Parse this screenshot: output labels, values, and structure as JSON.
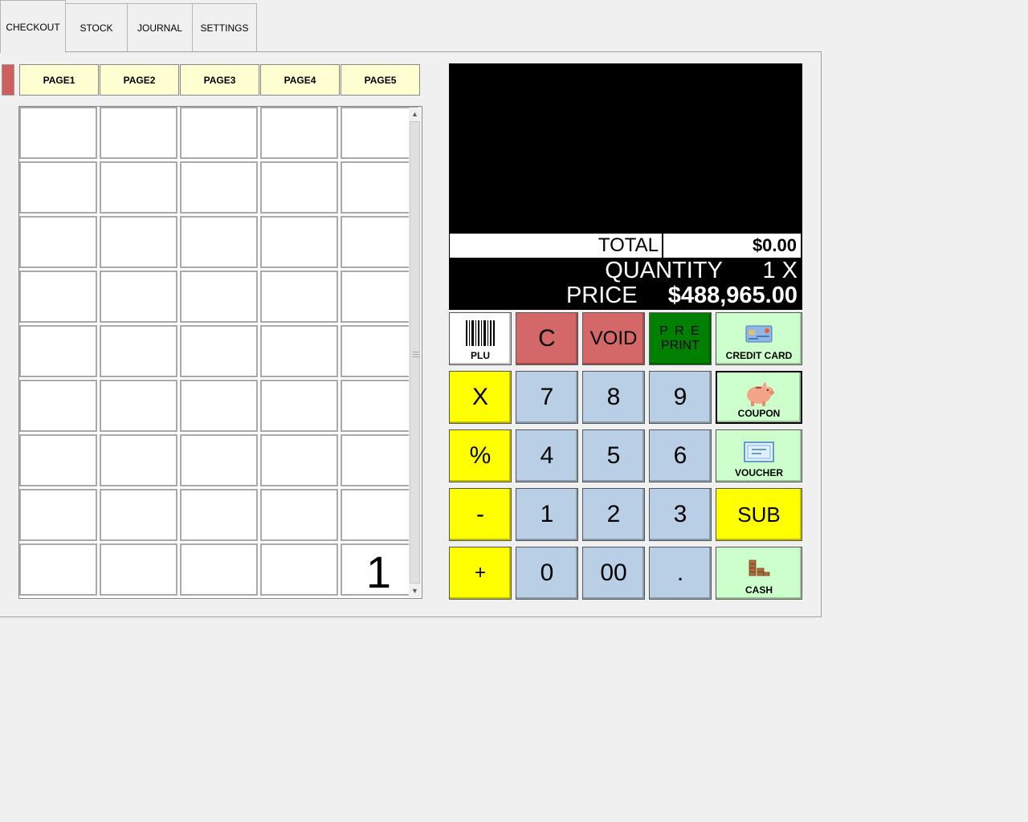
{
  "tabs": [
    {
      "label": "CHECKOUT",
      "active": true
    },
    {
      "label": "STOCK"
    },
    {
      "label": "JOURNAL"
    },
    {
      "label": "SETTINGS"
    }
  ],
  "pages": [
    "PAGE1",
    "PAGE2",
    "PAGE3",
    "PAGE4",
    "PAGE5"
  ],
  "grid": {
    "rows": 9,
    "cols": 5,
    "page_number": "1"
  },
  "display": {
    "total_label": "TOTAL",
    "total_value": "$0.00",
    "quantity_label": "QUANTITY",
    "quantity_value": "1 X",
    "price_label": "PRICE",
    "price_value": "$488,965.00"
  },
  "keys": {
    "plu": "PLU",
    "clear": "C",
    "void": "VOID",
    "preprint_line1": "P R E",
    "preprint_line2": "PRINT",
    "credit_card": "CREDIT CARD",
    "multiply": "X",
    "k7": "7",
    "k8": "8",
    "k9": "9",
    "coupon": "COUPON",
    "percent": "%",
    "k4": "4",
    "k5": "5",
    "k6": "6",
    "voucher": "VOUCHER",
    "minus": "-",
    "k1": "1",
    "k2": "2",
    "k3": "3",
    "sub": "SUB",
    "plus": "+",
    "k0": "0",
    "k00": "00",
    "dot": ".",
    "cash": "CASH"
  },
  "colors": {
    "yellow": "#ffff00",
    "blue": "#b8cfe6",
    "red": "#d46868",
    "light_green": "#cdffcd",
    "dark_green": "#008000",
    "page_button": "#ffffd2"
  }
}
